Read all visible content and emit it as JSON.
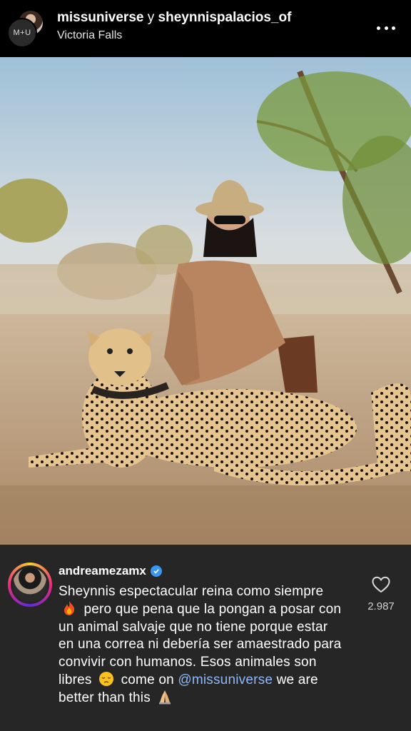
{
  "header": {
    "user_primary": "missuniverse",
    "conjunction": "y",
    "user_secondary": "sheynnispalacios_of",
    "location": "Victoria Falls",
    "avatar_text": "M+U",
    "more_icon": "more-horizontal-icon"
  },
  "comment": {
    "username": "andreamezamx",
    "verified": true,
    "text_1": "Sheynnis espectacular reina como siempre",
    "emoji_1": "fire-emoji",
    "text_2": "pero que pena que la pongan a posar con un animal salvaje que no tiene porque estar en una correa ni debería ser amaestrado para convivir con humanos. Esos animales son libres",
    "emoji_2": "pensive-emoji",
    "text_3": "come on",
    "mention": "@missuniverse",
    "text_4": "we are better than this",
    "emoji_3": "folded-hands-emoji",
    "like_count": "2.987",
    "like_icon": "heart-outline-icon"
  },
  "colors": {
    "background": "#000000",
    "comment_background": "#262626",
    "mention": "#8fb8f5",
    "verified_badge": "#3897f0"
  }
}
